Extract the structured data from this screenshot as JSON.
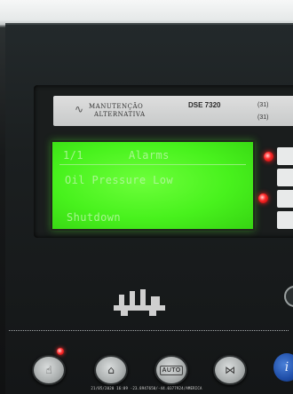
{
  "label_strip": {
    "brand_line1": "MANUTENÇÃO",
    "brand_line2": "ALTERNATIVA",
    "model": "DSE 7320",
    "phone_line1": "(31)",
    "phone_line2": "(31)"
  },
  "lcd": {
    "page": "1/1",
    "title": "Alarms",
    "alarm_text": "Oil Pressure Low",
    "alarm_type": "Shutdown",
    "screen_color": "#48f21d"
  },
  "buttons": {
    "auto_label": "AUTO",
    "info_label": "i",
    "info_color": "#1f4ea8"
  },
  "overlay": {
    "timestamp": "21/05/2020 16:09 -23.8947650/-44.0377924/AMERICA"
  },
  "icons": {
    "manual": "hand-icon",
    "test": "tower-icon",
    "auto": "auto-icon",
    "breaker": "bowtie-icon",
    "info": "info-icon",
    "generator": "generator-icon"
  },
  "colors": {
    "led_red": "#ff2a2a",
    "panel": "#1b1f20"
  }
}
